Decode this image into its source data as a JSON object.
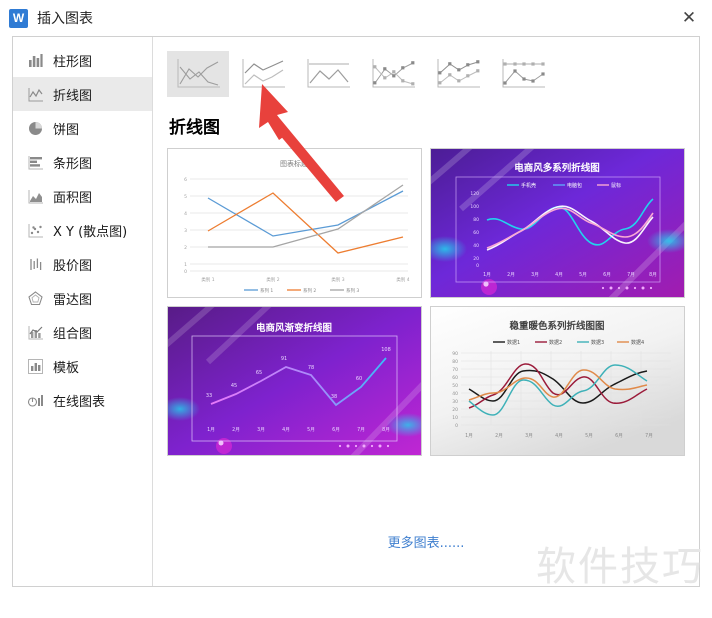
{
  "window": {
    "title": "插入图表",
    "logo_icon": "wps-writer-icon",
    "close_icon": "close-icon"
  },
  "sidebar": {
    "items": [
      {
        "label": "柱形图",
        "icon": "column-chart-icon",
        "active": false
      },
      {
        "label": "折线图",
        "icon": "line-chart-icon",
        "active": true
      },
      {
        "label": "饼图",
        "icon": "pie-chart-icon",
        "active": false
      },
      {
        "label": "条形图",
        "icon": "bar-chart-icon",
        "active": false
      },
      {
        "label": "面积图",
        "icon": "area-chart-icon",
        "active": false
      },
      {
        "label": "X Y (散点图)",
        "icon": "scatter-chart-icon",
        "active": false
      },
      {
        "label": "股价图",
        "icon": "stock-chart-icon",
        "active": false
      },
      {
        "label": "雷达图",
        "icon": "radar-chart-icon",
        "active": false
      },
      {
        "label": "组合图",
        "icon": "combo-chart-icon",
        "active": false
      },
      {
        "label": "模板",
        "icon": "template-icon",
        "active": false
      },
      {
        "label": "在线图表",
        "icon": "online-chart-icon",
        "active": false
      }
    ]
  },
  "main": {
    "thumbnails": [
      {
        "name": "line-chart-thumb",
        "selected": true
      },
      {
        "name": "stacked-line-chart-thumb",
        "selected": false
      },
      {
        "name": "percent-stacked-line-chart-thumb",
        "selected": false
      },
      {
        "name": "line-with-markers-thumb",
        "selected": false
      },
      {
        "name": "stacked-line-with-markers-thumb",
        "selected": false
      },
      {
        "name": "percent-stacked-line-with-markers-thumb",
        "selected": false
      }
    ],
    "section_title": "折线图",
    "more_link": "更多图表......"
  },
  "watermark": "软件技巧",
  "chart_data": [
    {
      "type": "line",
      "title": "图表标题",
      "card": "preview-default-line-chart",
      "categories": [
        "类别 1",
        "类别 2",
        "类别 3",
        "类别 4"
      ],
      "ytick_labels": [
        "0",
        "1",
        "2",
        "3",
        "4",
        "5",
        "6"
      ],
      "ylim": [
        0,
        6
      ],
      "grid": true,
      "legend_position": "bottom",
      "series": [
        {
          "name": "系列 1",
          "color": "#5B9BD5",
          "values": [
            4.3,
            2.5,
            3.5,
            4.5
          ]
        },
        {
          "name": "系列 2",
          "color": "#ED7D31",
          "values": [
            2.4,
            4.4,
            1.8,
            2.8
          ]
        },
        {
          "name": "系列 3",
          "color": "#A5A5A5",
          "values": [
            2.0,
            2.0,
            3.0,
            5.0
          ]
        }
      ]
    },
    {
      "type": "line",
      "title": "电商风多系列折线图",
      "card": "preview-ecommerce-multiseries-line-chart",
      "categories": [
        "1月",
        "2月",
        "3月",
        "4月",
        "5月",
        "6月",
        "7月",
        "8月"
      ],
      "ytick_labels": [
        "0",
        "20",
        "40",
        "60",
        "80",
        "100",
        "120"
      ],
      "ylim": [
        0,
        120
      ],
      "grid": false,
      "legend_position": "top",
      "background": "#6b21a8",
      "series": [
        {
          "name": "手机壳",
          "color": "#22d3ee",
          "values": [
            82,
            66,
            70,
            88,
            62,
            34,
            52,
            100
          ]
        },
        {
          "name": "电脑包",
          "color": "#60a5fa",
          "values": [
            33,
            46,
            62,
            88,
            80,
            64,
            46,
            80
          ]
        },
        {
          "name": "鼠标",
          "color": "#f9a8d4",
          "values": [
            36,
            50,
            66,
            84,
            70,
            72,
            60,
            88
          ]
        }
      ]
    },
    {
      "type": "line",
      "title": "电商风渐变折线图",
      "card": "preview-ecommerce-gradient-line-chart",
      "categories": [
        "1月",
        "2月",
        "3月",
        "4月",
        "5月",
        "6月",
        "7月",
        "8月"
      ],
      "values": [
        33,
        45,
        65,
        91,
        78,
        38,
        60,
        108
      ],
      "data_labels": [
        "33",
        "45",
        "65",
        "91",
        "78",
        "38",
        "60",
        "108"
      ],
      "ylim": [
        0,
        120
      ],
      "grid": false,
      "background": "#7e22ce",
      "line_color_start": "#e879f9",
      "line_color_end": "#38bdf8"
    },
    {
      "type": "line",
      "title": "稳重暖色系列折线图图",
      "card": "preview-warm-color-line-chart",
      "categories": [
        "1月",
        "2月",
        "3月",
        "4月",
        "5月",
        "6月",
        "7月"
      ],
      "ytick_labels": [
        "0",
        "10",
        "20",
        "30",
        "40",
        "50",
        "60",
        "70",
        "80",
        "90"
      ],
      "ylim": [
        0,
        90
      ],
      "grid": true,
      "legend_position": "top",
      "series": [
        {
          "name": "数据1",
          "color": "#1a1a1a",
          "values": [
            45,
            34,
            68,
            66,
            32,
            52,
            71
          ]
        },
        {
          "name": "数据2",
          "color": "#9b1b3a",
          "values": [
            21,
            38,
            80,
            44,
            64,
            31,
            48
          ]
        },
        {
          "name": "数据3",
          "color": "#3eb1b8",
          "values": [
            30,
            16,
            57,
            28,
            42,
            77,
            62
          ]
        },
        {
          "name": "数据4",
          "color": "#e08a4a",
          "values": [
            31,
            42,
            58,
            38,
            72,
            46,
            53
          ]
        }
      ]
    }
  ]
}
